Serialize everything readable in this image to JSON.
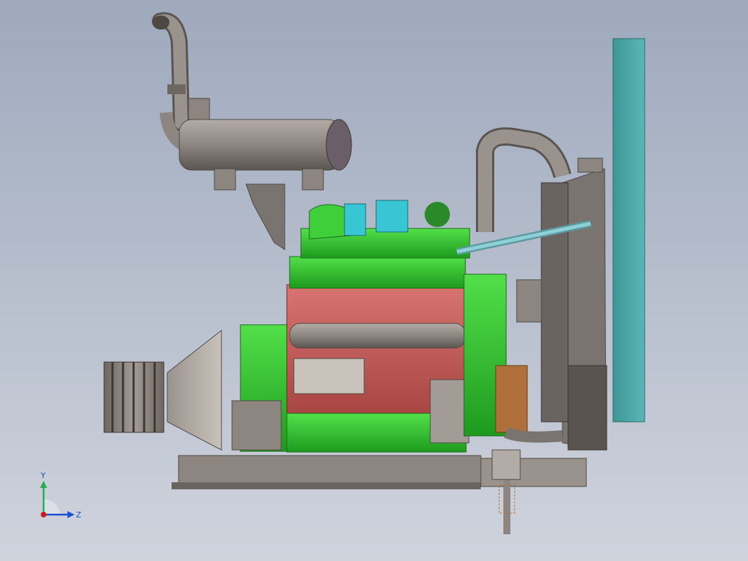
{
  "app": {
    "viewport": "cad-graphics-area"
  },
  "model": {
    "subject": "engine-assembly",
    "colors": {
      "background_top": "#9ea9bd",
      "background_bottom": "#cfd3dc",
      "metal": "#8c8580",
      "engine_block": "#c65c5a",
      "accessories": "#3ecf3a",
      "radiator_core": "#4aa3a3",
      "turbo": "#38c6d4",
      "pulley": "#b0703c"
    }
  },
  "triad": {
    "y_label": "Y",
    "z_label": "Z",
    "y_color": "#22b14c",
    "z_color": "#1a4fd0",
    "x_color": "#d01a1a"
  }
}
